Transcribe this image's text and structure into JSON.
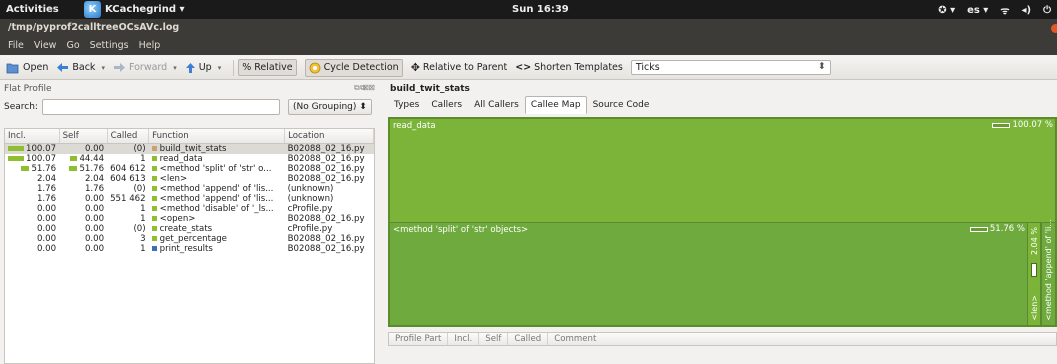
{
  "topbar": {
    "activities": "Activities",
    "app_name": "KCachegrind ▾",
    "clock": "Sun 16:39",
    "lang": "es ▾",
    "status_icons": [
      "accessibility-icon",
      "network-icon",
      "volume-icon",
      "power-icon"
    ]
  },
  "window": {
    "title": "/tmp/pyprof2calltreeOCsAVc.log",
    "menu": [
      "File",
      "View",
      "Go",
      "Settings",
      "Help"
    ]
  },
  "toolbar": {
    "open": "Open",
    "back": "Back",
    "forward": "Forward",
    "up": "Up",
    "relative": "% Relative",
    "cycle_detection": "Cycle Detection",
    "relative_to_parent": "Relative to Parent",
    "shorten_templates": "Shorten Templates",
    "event_type": "Ticks"
  },
  "flat_profile": {
    "title": "Flat Profile",
    "search_label": "Search:",
    "search_value": "",
    "grouping": "(No Grouping)",
    "columns": [
      "Incl.",
      "Self",
      "Called",
      "Function",
      "Location"
    ],
    "rows": [
      {
        "incl": "100.07",
        "incl_frac": 1.0,
        "self": "0.00",
        "self_frac": 0,
        "called": "(0)",
        "color": "#c9a36b",
        "function": "build_twit_stats",
        "location": "B02088_02_16.py",
        "selected": true
      },
      {
        "incl": "100.07",
        "incl_frac": 1.0,
        "self": "44.44",
        "self_frac": 0.44,
        "called": "1",
        "color": "#8fbf2f",
        "function": "read_data",
        "location": "B02088_02_16.py"
      },
      {
        "incl": "51.76",
        "incl_frac": 0.52,
        "self": "51.76",
        "self_frac": 0.52,
        "called": "604 612",
        "color": "#8fbf2f",
        "function": "<method 'split' of 'str' o...",
        "location": "B02088_02_16.py"
      },
      {
        "incl": "2.04",
        "incl_frac": 0,
        "self": "2.04",
        "self_frac": 0,
        "called": "604 613",
        "color": "#8fbf2f",
        "function": "<len>",
        "location": "B02088_02_16.py"
      },
      {
        "incl": "1.76",
        "incl_frac": 0,
        "self": "1.76",
        "self_frac": 0,
        "called": "(0)",
        "color": "#8fbf2f",
        "function": "<method 'append' of 'lis...",
        "location": "(unknown)"
      },
      {
        "incl": "1.76",
        "incl_frac": 0,
        "self": "0.00",
        "self_frac": 0,
        "called": "551 462",
        "color": "#8fbf2f",
        "function": "<method 'append' of 'lis...",
        "location": "(unknown)"
      },
      {
        "incl": "0.00",
        "incl_frac": 0,
        "self": "0.00",
        "self_frac": 0,
        "called": "1",
        "color": "#8fbf2f",
        "function": "<method 'disable' of '_ls...",
        "location": "cProfile.py"
      },
      {
        "incl": "0.00",
        "incl_frac": 0,
        "self": "0.00",
        "self_frac": 0,
        "called": "1",
        "color": "#8fbf2f",
        "function": "<open>",
        "location": "B02088_02_16.py"
      },
      {
        "incl": "0.00",
        "incl_frac": 0,
        "self": "0.00",
        "self_frac": 0,
        "called": "(0)",
        "color": "#8fbf2f",
        "function": "create_stats",
        "location": "cProfile.py"
      },
      {
        "incl": "0.00",
        "incl_frac": 0,
        "self": "0.00",
        "self_frac": 0,
        "called": "3",
        "color": "#8fbf2f",
        "function": "get_percentage",
        "location": "B02088_02_16.py"
      },
      {
        "incl": "0.00",
        "incl_frac": 0,
        "self": "0.00",
        "self_frac": 0,
        "called": "1",
        "color": "#3c6fb8",
        "function": "print_results",
        "location": "B02088_02_16.py"
      }
    ]
  },
  "detail": {
    "function_title": "build_twit_stats",
    "tabs": [
      "Types",
      "Callers",
      "All Callers",
      "Callee Map",
      "Source Code"
    ],
    "active_tab": "Callee Map",
    "callee_map": {
      "read_data_label": "read_data",
      "read_data_pct": "100.07 %",
      "split_label": "<method 'split' of 'str' objects>",
      "split_pct": "51.76 %",
      "len_pct": "2.04 %",
      "len_label": "<len>",
      "append_label": "<method 'append' of 'li..."
    },
    "bottom_columns": [
      "Profile Part",
      "Incl.",
      "Self",
      "Called",
      "Comment"
    ]
  }
}
